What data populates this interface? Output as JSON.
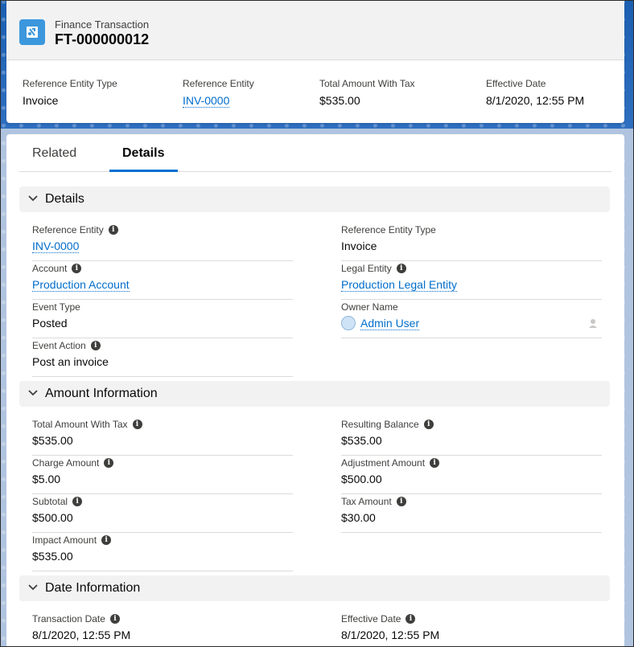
{
  "header": {
    "record_type": "Finance Transaction",
    "record_name": "FT-000000012",
    "icon": "finance-transaction-icon",
    "highlights": [
      {
        "label": "Reference Entity Type",
        "value": "Invoice",
        "is_link": false
      },
      {
        "label": "Reference Entity",
        "value": "INV-0000",
        "is_link": true
      },
      {
        "label": "Total Amount With Tax",
        "value": "$535.00",
        "is_link": false
      },
      {
        "label": "Effective Date",
        "value": "8/1/2020, 12:55 PM",
        "is_link": false
      }
    ]
  },
  "tabs": [
    {
      "label": "Related",
      "active": false
    },
    {
      "label": "Details",
      "active": true
    }
  ],
  "sections": {
    "details": {
      "title": "Details",
      "fields": {
        "reference_entity": {
          "label": "Reference Entity",
          "value": "INV-0000"
        },
        "reference_entity_type": {
          "label": "Reference Entity Type",
          "value": "Invoice"
        },
        "account": {
          "label": "Account",
          "value": "Production Account"
        },
        "legal_entity": {
          "label": "Legal Entity",
          "value": "Production Legal Entity"
        },
        "event_type": {
          "label": "Event Type",
          "value": "Posted"
        },
        "owner_name": {
          "label": "Owner Name",
          "value": "Admin User"
        },
        "event_action": {
          "label": "Event Action",
          "value": "Post an invoice"
        }
      }
    },
    "amount": {
      "title": "Amount Information",
      "fields": {
        "total_amount_with_tax": {
          "label": "Total Amount With Tax",
          "value": "$535.00"
        },
        "resulting_balance": {
          "label": "Resulting Balance",
          "value": "$535.00"
        },
        "charge_amount": {
          "label": "Charge Amount",
          "value": "$5.00"
        },
        "adjustment_amount": {
          "label": "Adjustment Amount",
          "value": "$500.00"
        },
        "subtotal": {
          "label": "Subtotal",
          "value": "$500.00"
        },
        "tax_amount": {
          "label": "Tax Amount",
          "value": "$30.00"
        },
        "impact_amount": {
          "label": "Impact Amount",
          "value": "$535.00"
        }
      }
    },
    "date": {
      "title": "Date Information",
      "fields": {
        "transaction_date": {
          "label": "Transaction Date",
          "value": "8/1/2020, 12:55 PM"
        },
        "effective_date": {
          "label": "Effective Date",
          "value": "8/1/2020, 12:55 PM"
        }
      }
    }
  },
  "colors": {
    "brand_blue": "#0070d2",
    "link": "#006dcc",
    "record_icon": "#3c97dd"
  }
}
